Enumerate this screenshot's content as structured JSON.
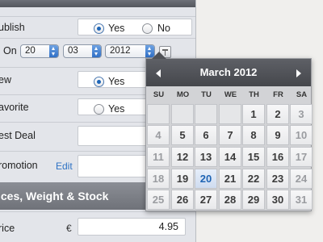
{
  "form": {
    "publish": {
      "label": "ublish",
      "yes": "Yes",
      "no": "No",
      "on_label": "On"
    },
    "date_selects": {
      "day": "20",
      "month": "03",
      "year": "2012"
    },
    "new_row": {
      "label": "ew",
      "yes": "Yes"
    },
    "favorite": {
      "label": "avorite",
      "yes": "Yes"
    },
    "best_deal": {
      "label": "est Deal"
    },
    "promotion": {
      "label": "romotion",
      "edit": "Edit"
    },
    "section_title": "ices, Weight & Stock",
    "price": {
      "label": "rice",
      "currency": "€",
      "value": "4.95"
    }
  },
  "calendar": {
    "title": "March 2012",
    "days_of_week": [
      "SU",
      "MO",
      "TU",
      "WE",
      "TH",
      "FR",
      "SA"
    ],
    "weeks": [
      [
        "",
        "",
        "",
        "",
        "1",
        "2",
        "3"
      ],
      [
        "4",
        "5",
        "6",
        "7",
        "8",
        "9",
        "10"
      ],
      [
        "11",
        "12",
        "13",
        "14",
        "15",
        "16",
        "17"
      ],
      [
        "18",
        "19",
        "20",
        "21",
        "22",
        "23",
        "24"
      ],
      [
        "25",
        "26",
        "27",
        "28",
        "29",
        "30",
        "31"
      ]
    ],
    "selected_day": "20"
  }
}
